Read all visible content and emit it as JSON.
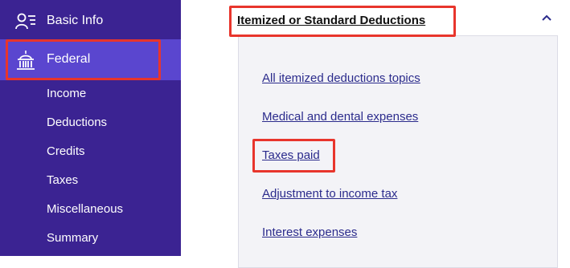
{
  "sidebar": {
    "basic_info": {
      "label": "Basic Info",
      "icon": "person-list-icon"
    },
    "federal": {
      "label": "Federal",
      "icon": "capitol-building-icon"
    },
    "sub_items": [
      "Income",
      "Deductions",
      "Credits",
      "Taxes",
      "Miscellaneous",
      "Summary"
    ],
    "colors": {
      "background": "#3b2392",
      "active": "#5a46cf",
      "highlight": "#e8352c"
    }
  },
  "main": {
    "section_title": "Itemized or Standard Deductions",
    "chevron_icon": "chevron-up-icon",
    "links": [
      "All itemized deductions topics",
      "Medical and dental expenses",
      "Taxes paid",
      "Adjustment to income tax",
      "Interest expenses"
    ]
  }
}
